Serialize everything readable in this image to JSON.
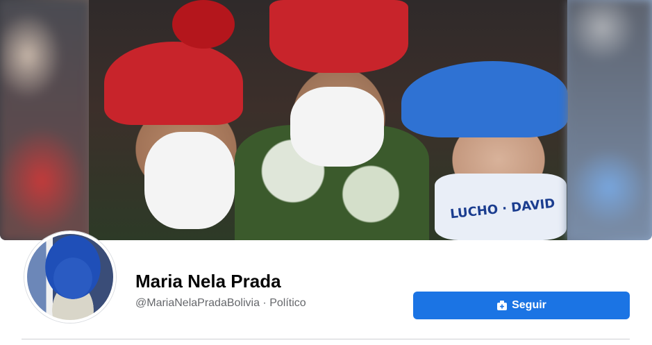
{
  "profile": {
    "name": "Maria Nela Prada",
    "handle": "@MariaNelaPradaBolivia",
    "separator": " · ",
    "category": "Político"
  },
  "actions": {
    "follow_label": "Seguir",
    "follow_icon": "follow-icon",
    "accent_color": "#1b74e4"
  },
  "cover": {
    "mask_text": "LUCHO · DAVID"
  }
}
